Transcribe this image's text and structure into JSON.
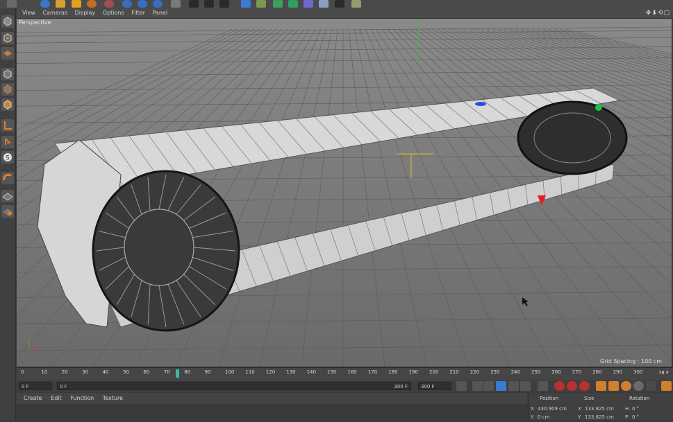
{
  "viewport_menu": [
    "View",
    "Cameras",
    "Display",
    "Options",
    "Filter",
    "Panel"
  ],
  "viewport_nav_icons": "✥⬇⟲▢",
  "viewport": {
    "label": "Perspective",
    "grid_spacing": "Grid Spacing : 100 cm"
  },
  "timeline": {
    "ticks": [
      "0",
      "10",
      "20",
      "30",
      "40",
      "50",
      "60",
      "70",
      "80",
      "90",
      "100",
      "110",
      "120",
      "130",
      "140",
      "150",
      "160",
      "170",
      "180",
      "190",
      "200",
      "210",
      "220",
      "230",
      "240",
      "250",
      "260",
      "270",
      "280",
      "290",
      "300"
    ],
    "current_frame": "78 F"
  },
  "transport": {
    "start_field": "0 F",
    "range_start": "0 F",
    "range_end": "300 F",
    "end_field": "300 F"
  },
  "bottom_menu": [
    "Create",
    "Edit",
    "Function",
    "Texture"
  ],
  "coordinates": {
    "headers": {
      "position": "Position",
      "size": "Size",
      "rotation": "Rotation"
    },
    "row1": {
      "x_label": "X",
      "x_value": "430.909 cm",
      "sx_label": "X",
      "sx_value": "133.825 cm",
      "h_label": "H",
      "h_value": "0 °"
    },
    "row2": {
      "y_label": "Y",
      "y_value": "0 cm",
      "sy_label": "Y",
      "sy_value": "133.825 cm",
      "p_label": "P",
      "p_value": "0 °"
    }
  },
  "colors": {
    "accent_blue": "#3a7bd5",
    "playhead": "#3fb6a8",
    "axis_red": "#e02020",
    "axis_green": "#20c040",
    "axis_blue": "#2050e0"
  }
}
